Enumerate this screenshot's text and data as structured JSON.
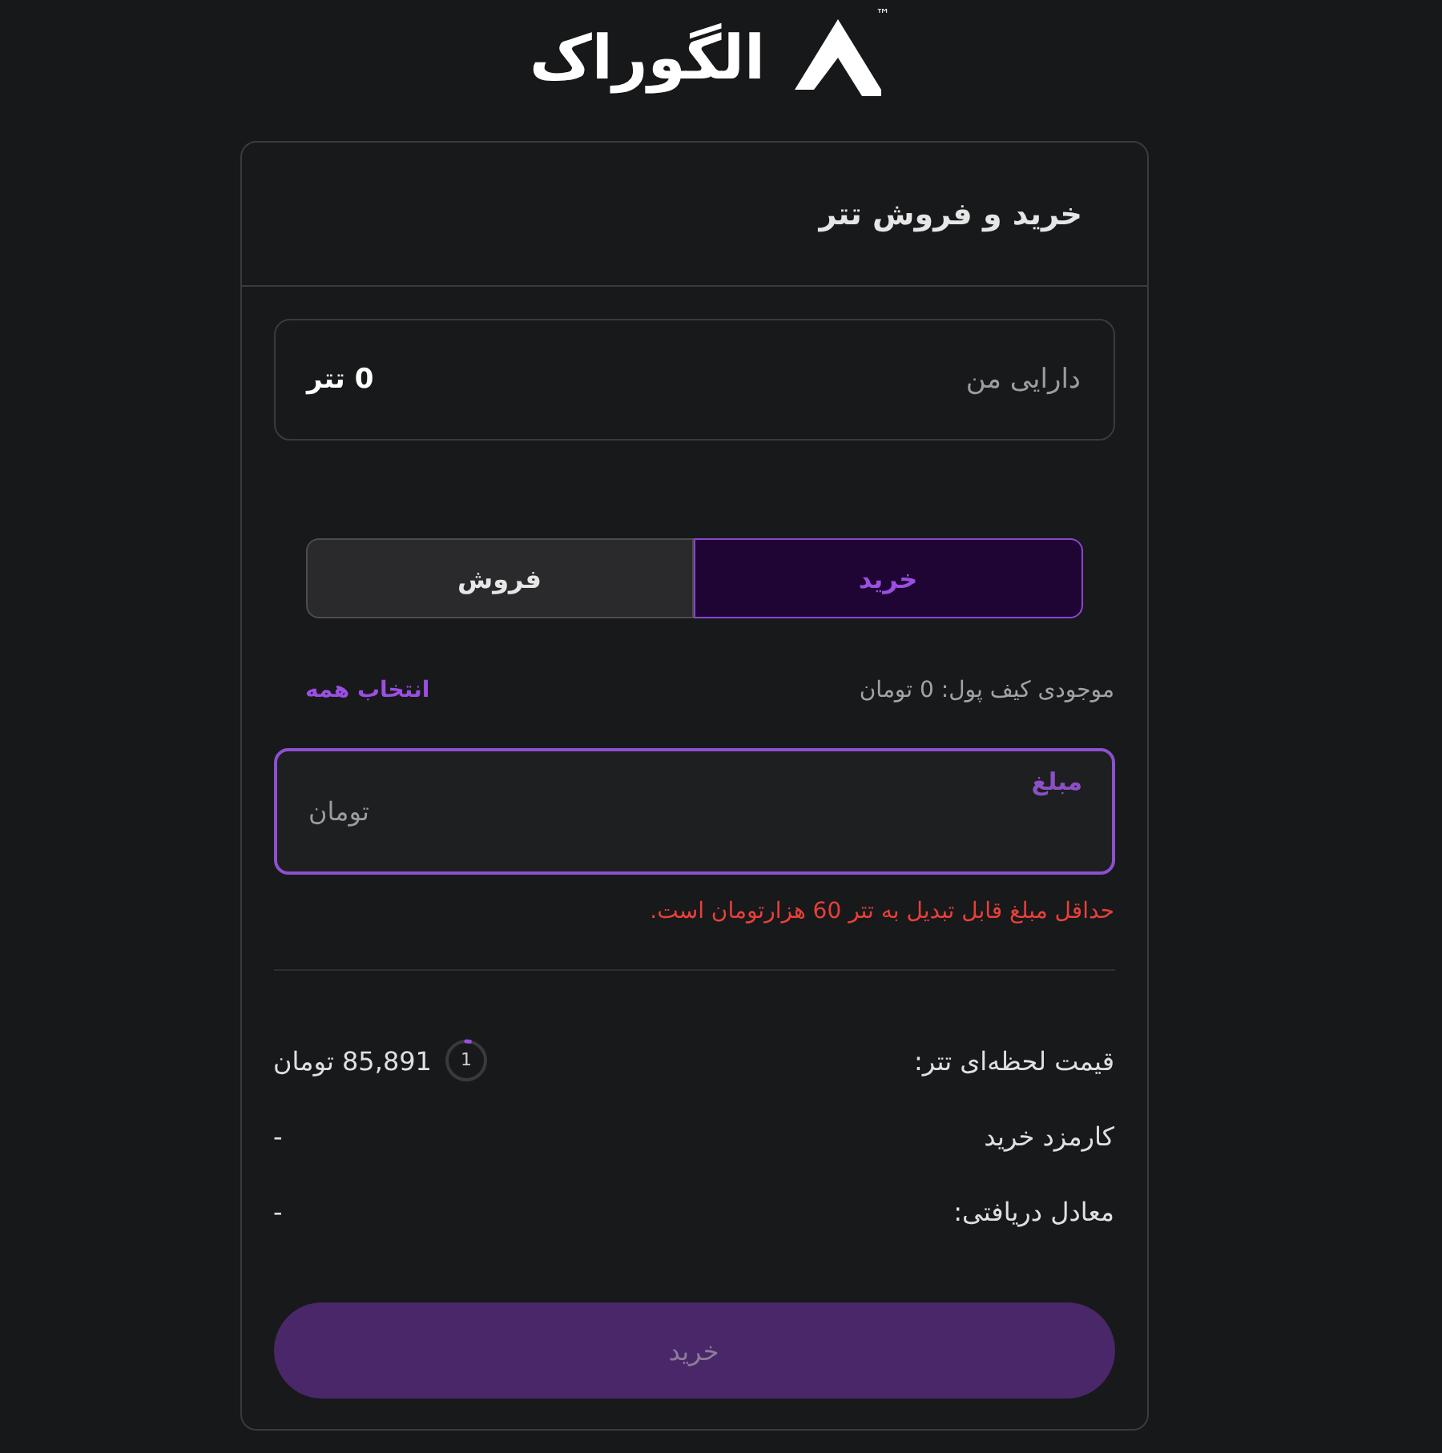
{
  "logo": {
    "name": "الگوراک",
    "trademark": "™"
  },
  "title": "خرید و فروش تتر",
  "holdings": {
    "label": "دارایی من",
    "value": "0 تتر"
  },
  "tabs": [
    {
      "label": "خرید",
      "selected": true
    },
    {
      "label": "فروش",
      "selected": false
    }
  ],
  "wallet": {
    "balance": "موجودی کیف پول: 0 تومان",
    "select_all": "انتخاب همه"
  },
  "amount_field": {
    "label": "مبلغ",
    "unit": "تومان",
    "focused": true
  },
  "error": "حداقل مبلغ قابل تبدیل به تتر 60 هزارتومان است.",
  "details": [
    {
      "label": "قیمت لحظه‌ای تتر:",
      "value": "85,891 تومان",
      "timer": {
        "text": "1",
        "level": 0.03
      }
    },
    {
      "label": "کارمزد خرید",
      "value": "-"
    },
    {
      "label": "معادل دریافتی:",
      "value": "-"
    }
  ],
  "submit": {
    "label": "خرید",
    "disabled": true
  }
}
